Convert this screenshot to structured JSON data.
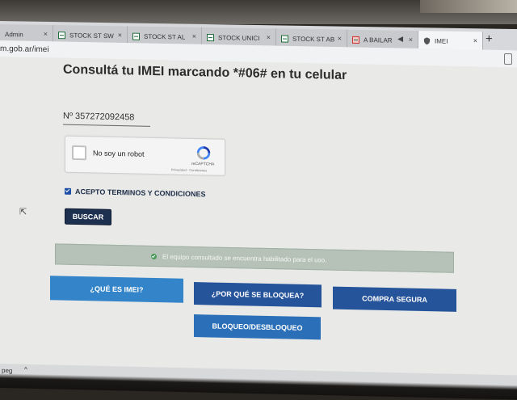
{
  "browser": {
    "tabs": [
      {
        "label": "Admin",
        "icon": "none"
      },
      {
        "label": "STOCK ST SW",
        "icon": "sheets-icon"
      },
      {
        "label": "STOCK ST AL",
        "icon": "sheets-icon"
      },
      {
        "label": "STOCK UNICI",
        "icon": "sheets-icon"
      },
      {
        "label": "STOCK ST AB",
        "icon": "sheets-icon"
      },
      {
        "label": "A BAILAR",
        "icon": "video-icon"
      },
      {
        "label": "IMEI",
        "icon": "shield-icon"
      }
    ],
    "new_tab": "+",
    "close_glyph": "×",
    "url": "m.gob.ar/imei"
  },
  "page": {
    "heading": "Consultá tu IMEI marcando *#06# en tu celular",
    "imei_value": "Nº  357272092458",
    "captcha": {
      "label": "No soy un robot",
      "brand": "reCAPTCHA",
      "links": "Privacidad - Condiciones"
    },
    "terms_label": "ACEPTO TERMINOS Y CONDICIONES",
    "search_button": "BUSCAR",
    "result_message": "El equipo consultado se encuentra habilitado para el uso.",
    "nav_buttons": {
      "imei": "¿QUÉ ES IMEI?",
      "bloquea": "¿POR QUÉ SE BLOQUEA?",
      "compra": "COMPRA SEGURA",
      "bloqueo": "BLOQUEO/DESBLOQUEO"
    },
    "colors": {
      "primary_blue": "#2a6fb8",
      "dark_navy": "#1e3050",
      "success_green": "#4a9a5a"
    }
  },
  "downloads": {
    "file_label": "peg",
    "chevron": "^"
  }
}
